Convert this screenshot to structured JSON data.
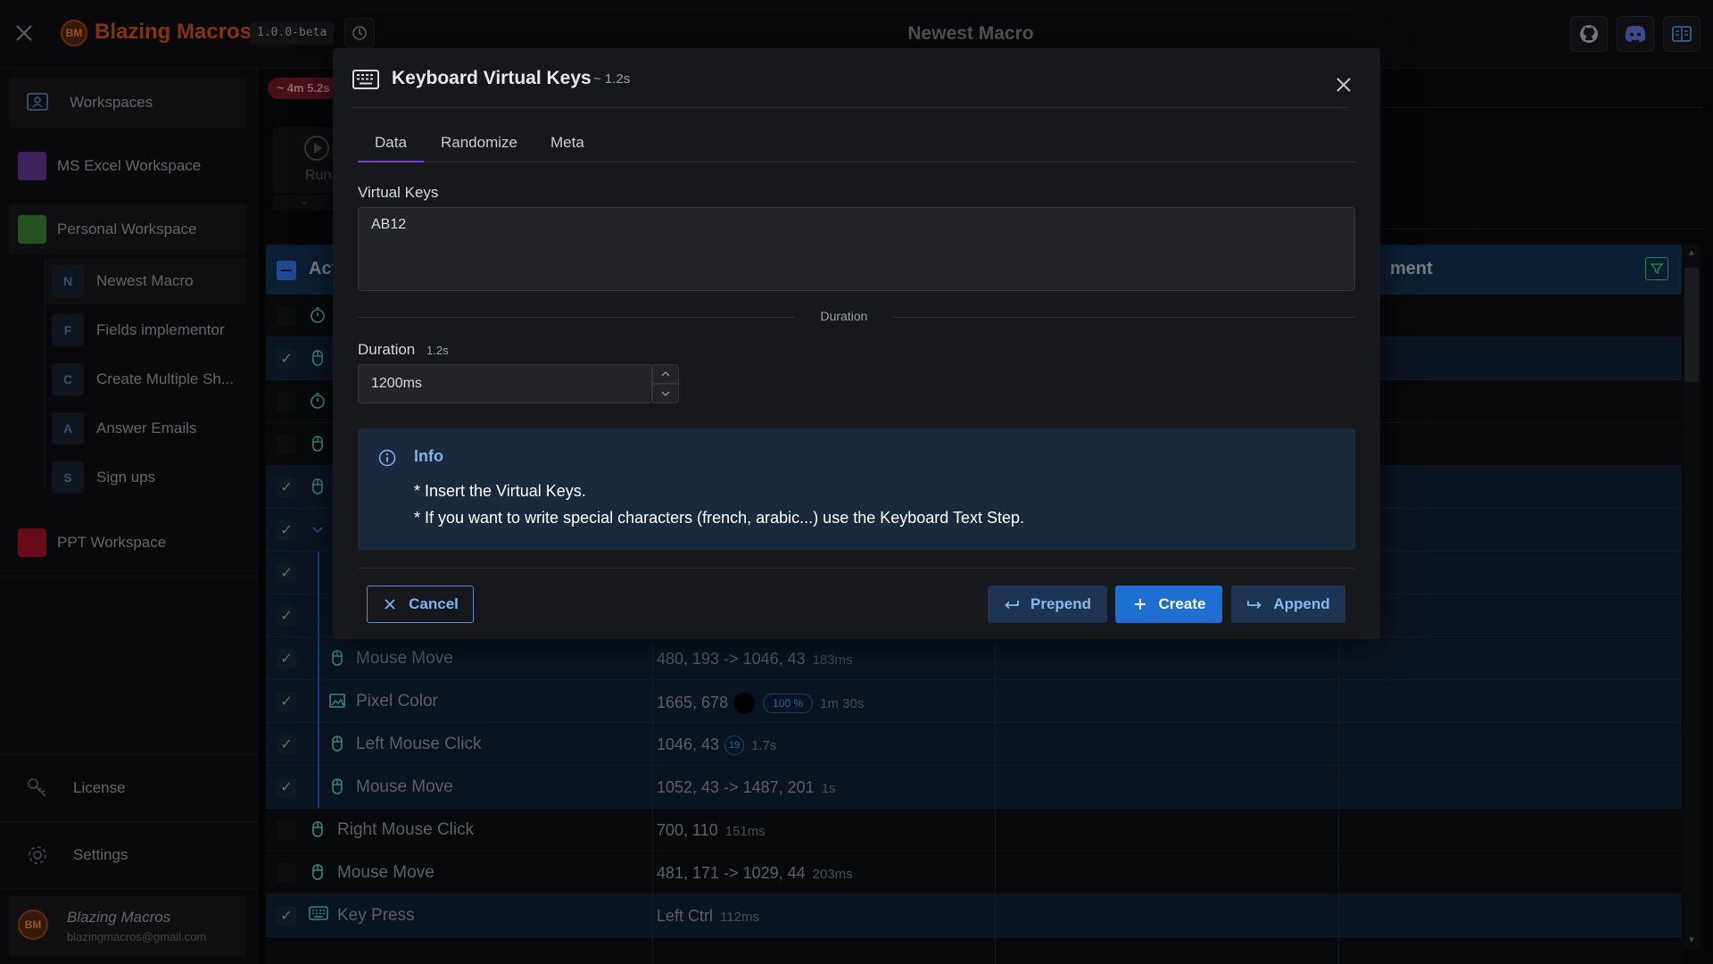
{
  "titlebar": {
    "app_name": "Blazing Macros",
    "logo_text": "BM",
    "version": "1.0.0-beta",
    "window_title": "Newest Macro"
  },
  "sidebar": {
    "workspaces_label": "Workspaces",
    "workspaces": [
      {
        "name": "MS Excel Workspace",
        "color": "#6b3fa0"
      },
      {
        "name": "Personal Workspace",
        "color": "#3f8f3a"
      },
      {
        "name": "PPT Workspace",
        "color": "#b3162f"
      }
    ],
    "macros": [
      {
        "letter": "N",
        "name": "Newest Macro"
      },
      {
        "letter": "F",
        "name": "Fields implementor"
      },
      {
        "letter": "C",
        "name": "Create Multiple Sh..."
      },
      {
        "letter": "A",
        "name": "Answer Emails"
      },
      {
        "letter": "S",
        "name": "Sign ups"
      }
    ],
    "license_label": "License",
    "settings_label": "Settings",
    "user": {
      "name": "Blazing Macros",
      "email": "blazingmacros@gmail.com",
      "initials": "BM"
    }
  },
  "main": {
    "time_badge": "~ 4m 5.2s",
    "run_label": "Run",
    "table": {
      "header_action": "Act",
      "header_comment": "ment",
      "rows": [
        {
          "name": "Mouse Move",
          "value": "480, 193 -> 1046, 43",
          "duration": "183ms"
        },
        {
          "name": "Pixel Color",
          "value": "1665, 678",
          "percent": "100 %",
          "duration": "1m 30s"
        },
        {
          "name": "Left Mouse Click",
          "value": "1046, 43",
          "clicks": "19",
          "duration": "1.7s"
        },
        {
          "name": "Mouse Move",
          "value": "1052, 43 -> 1487, 201",
          "duration": "1s"
        },
        {
          "name": "Right Mouse Click",
          "value": "700, 110",
          "duration": "151ms"
        },
        {
          "name": "Mouse Move",
          "value": "481, 171 -> 1029, 44",
          "duration": "203ms"
        },
        {
          "name": "Key Press",
          "value": "Left Ctrl",
          "duration": "112ms"
        }
      ]
    }
  },
  "modal": {
    "title": "Keyboard Virtual Keys",
    "duration_hint": "~ 1.2s",
    "tabs": [
      "Data",
      "Randomize",
      "Meta"
    ],
    "virtual_keys_label": "Virtual Keys",
    "virtual_keys_value": "AB12",
    "divider_label": "Duration",
    "duration_label": "Duration",
    "duration_sub": "1.2s",
    "duration_value": "1200ms",
    "info": {
      "title": "Info",
      "line1": "* Insert the Virtual Keys.",
      "line2": "* If you want to write special characters (french, arabic...) use the Keyboard Text Step."
    },
    "buttons": {
      "cancel": "Cancel",
      "prepend": "Prepend",
      "create": "Create",
      "append": "Append"
    }
  }
}
